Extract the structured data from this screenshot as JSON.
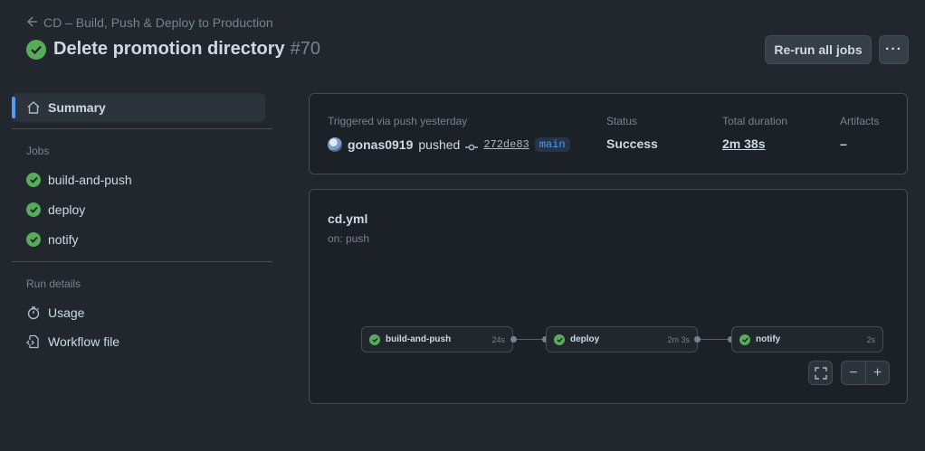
{
  "header": {
    "back_label": "CD – Build, Push & Deploy to Production",
    "title": "Delete promotion directory",
    "run_number": "#70",
    "rerun_label": "Re-run all jobs",
    "more_label": "···"
  },
  "sidebar": {
    "summary_label": "Summary",
    "jobs_heading": "Jobs",
    "jobs": [
      {
        "label": "build-and-push",
        "status": "success"
      },
      {
        "label": "deploy",
        "status": "success"
      },
      {
        "label": "notify",
        "status": "success"
      }
    ],
    "run_details_heading": "Run details",
    "usage_label": "Usage",
    "workflow_file_label": "Workflow file"
  },
  "summary": {
    "trigger_label": "Triggered via push yesterday",
    "user": "gonas0919",
    "action": "pushed",
    "commit_sha": "272de83",
    "branch": "main",
    "status_label": "Status",
    "status_value": "Success",
    "duration_label": "Total duration",
    "duration_value": "2m 38s",
    "artifacts_label": "Artifacts",
    "artifacts_value": "–"
  },
  "graph": {
    "workflow_file": "cd.yml",
    "trigger": "on: push",
    "jobs": [
      {
        "name": "build-and-push",
        "duration": "24s"
      },
      {
        "name": "deploy",
        "duration": "2m 3s"
      },
      {
        "name": "notify",
        "duration": "2s"
      }
    ],
    "zoom_out_label": "−",
    "zoom_in_label": "+"
  },
  "colors": {
    "background": "#22272e",
    "success": "#57ab5a",
    "accent": "#539bf5"
  }
}
